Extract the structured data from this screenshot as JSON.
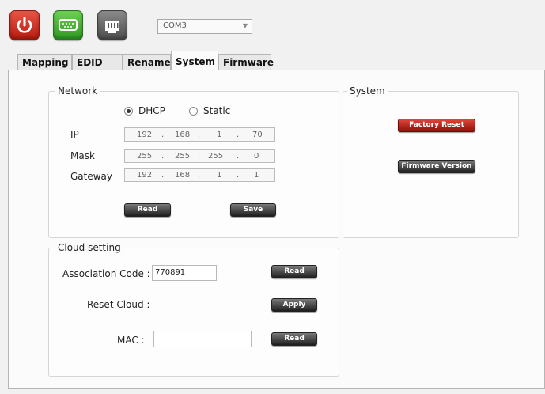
{
  "toolbar": {
    "port_value": "COM3"
  },
  "tabs": [
    "Mapping",
    "EDID",
    "Rename",
    "System",
    "Firmware"
  ],
  "network": {
    "legend": "Network",
    "dhcp_label": "DHCP",
    "static_label": "Static",
    "ip_label": "IP",
    "mask_label": "Mask",
    "gateway_label": "Gateway",
    "ip": [
      "192",
      "168",
      "1",
      "70"
    ],
    "mask": [
      "255",
      "255",
      "255",
      "0"
    ],
    "gateway": [
      "192",
      "168",
      "1",
      "1"
    ],
    "read_label": "Read",
    "save_label": "Save"
  },
  "system": {
    "legend": "System",
    "factory_reset_label": "Factory Reset",
    "firmware_version_label": "Firmware Version"
  },
  "cloud": {
    "legend": "Cloud setting",
    "association_label": "Association Code :",
    "association_value": "770891",
    "association_read_label": "Read",
    "reset_label": "Reset Cloud :",
    "apply_label": "Apply",
    "mac_label": "MAC :",
    "mac_value": "",
    "mac_read_label": "Read"
  },
  "colors": {
    "power": "#c8281b",
    "serial": "#43b030",
    "network": "#666666"
  }
}
